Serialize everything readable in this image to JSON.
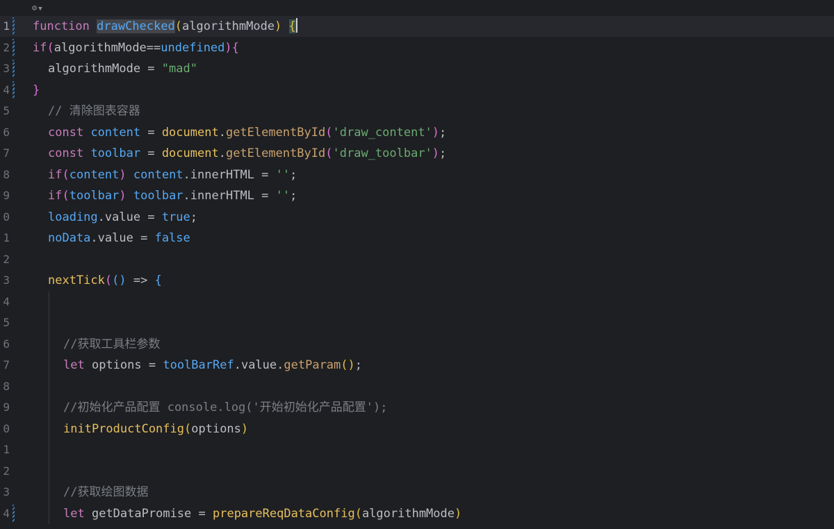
{
  "editor": {
    "inlay_hint": {
      "icon": "ai-assistant-icon"
    },
    "current_line": 1,
    "lines": [
      {
        "number": "1",
        "indent": 0,
        "tokens": [
          [
            "function",
            "kw2"
          ],
          [
            " "
          ],
          [
            "drawChecked",
            "fnhl"
          ],
          [
            "(",
            "p1"
          ],
          [
            "algorithmMode",
            "param"
          ],
          [
            ")",
            "p1"
          ],
          [
            " "
          ],
          [
            "{",
            "brhl"
          ]
        ]
      },
      {
        "number": "2",
        "indent": 0,
        "tokens": [
          [
            "if",
            "kw2"
          ],
          [
            "(",
            "p2"
          ],
          [
            "algorithmMode",
            "param"
          ],
          [
            "==",
            "op"
          ],
          [
            "undefined",
            "fn"
          ],
          [
            ")",
            "p2"
          ],
          [
            "{",
            "p2"
          ]
        ]
      },
      {
        "number": "3",
        "indent": 1,
        "tokens": [
          [
            "algorithmMode",
            "param"
          ],
          [
            " = "
          ],
          [
            "\"mad\"",
            "str"
          ]
        ]
      },
      {
        "number": "4",
        "indent": 0,
        "tokens": [
          [
            "}",
            "p2"
          ]
        ]
      },
      {
        "number": "5",
        "indent": 1,
        "tokens": [
          [
            "// 清除图表容器",
            "cmt"
          ]
        ]
      },
      {
        "number": "6",
        "indent": 1,
        "tokens": [
          [
            "const",
            "kw2"
          ],
          [
            " "
          ],
          [
            "content",
            "local"
          ],
          [
            " = "
          ],
          [
            "document",
            "fncall"
          ],
          [
            "."
          ],
          [
            "getElementById",
            "method"
          ],
          [
            "(",
            "p2"
          ],
          [
            "'draw_content'",
            "str"
          ],
          [
            ")",
            "p2"
          ],
          [
            ";"
          ]
        ]
      },
      {
        "number": "7",
        "indent": 1,
        "tokens": [
          [
            "const",
            "kw2"
          ],
          [
            " "
          ],
          [
            "toolbar",
            "local"
          ],
          [
            " = "
          ],
          [
            "document",
            "fncall"
          ],
          [
            "."
          ],
          [
            "getElementById",
            "method"
          ],
          [
            "(",
            "p2"
          ],
          [
            "'draw_toolbar'",
            "str"
          ],
          [
            ")",
            "p2"
          ],
          [
            ";"
          ]
        ]
      },
      {
        "number": "8",
        "indent": 1,
        "tokens": [
          [
            "if",
            "kw2"
          ],
          [
            "(",
            "p2"
          ],
          [
            "content",
            "local"
          ],
          [
            ")",
            "p2"
          ],
          [
            " "
          ],
          [
            "content",
            "local"
          ],
          [
            "."
          ],
          [
            "innerHTML",
            "var"
          ],
          [
            " = "
          ],
          [
            "''",
            "str"
          ],
          [
            ";"
          ]
        ]
      },
      {
        "number": "9",
        "indent": 1,
        "tokens": [
          [
            "if",
            "kw2"
          ],
          [
            "(",
            "p2"
          ],
          [
            "toolbar",
            "local"
          ],
          [
            ")",
            "p2"
          ],
          [
            " "
          ],
          [
            "toolbar",
            "local"
          ],
          [
            "."
          ],
          [
            "innerHTML",
            "var"
          ],
          [
            " = "
          ],
          [
            "''",
            "str"
          ],
          [
            ";"
          ]
        ]
      },
      {
        "number": "0",
        "indent": 1,
        "tokens": [
          [
            "loading",
            "local"
          ],
          [
            "."
          ],
          [
            "value",
            "var"
          ],
          [
            " = "
          ],
          [
            "true",
            "fn"
          ],
          [
            ";"
          ]
        ]
      },
      {
        "number": "1",
        "indent": 1,
        "tokens": [
          [
            "noData",
            "local"
          ],
          [
            "."
          ],
          [
            "value",
            "var"
          ],
          [
            " = "
          ],
          [
            "false",
            "fn"
          ]
        ]
      },
      {
        "number": "2",
        "indent": 0,
        "tokens": []
      },
      {
        "number": "3",
        "indent": 1,
        "tokens": [
          [
            "nextTick",
            "fncall"
          ],
          [
            "(",
            "p2"
          ],
          [
            "()",
            "p3"
          ],
          [
            " => "
          ],
          [
            "{",
            "p3"
          ]
        ]
      },
      {
        "number": "4",
        "indent": 2,
        "tokens": []
      },
      {
        "number": "5",
        "indent": 2,
        "tokens": []
      },
      {
        "number": "6",
        "indent": 2,
        "tokens": [
          [
            "//获取工具栏参数",
            "cmt"
          ]
        ]
      },
      {
        "number": "7",
        "indent": 2,
        "tokens": [
          [
            "let",
            "kw2"
          ],
          [
            " "
          ],
          [
            "options",
            "var"
          ],
          [
            " = "
          ],
          [
            "toolBarRef",
            "local"
          ],
          [
            "."
          ],
          [
            "value",
            "var"
          ],
          [
            "."
          ],
          [
            "getParam",
            "method"
          ],
          [
            "(",
            "p1"
          ],
          [
            ")",
            "p1"
          ],
          [
            ";"
          ]
        ]
      },
      {
        "number": "8",
        "indent": 2,
        "tokens": []
      },
      {
        "number": "9",
        "indent": 2,
        "tokens": [
          [
            "//初始化产品配置 console.log('开始初始化产品配置');",
            "cmt"
          ]
        ]
      },
      {
        "number": "0",
        "indent": 2,
        "tokens": [
          [
            "initProductConfig",
            "fncall"
          ],
          [
            "(",
            "p1"
          ],
          [
            "options",
            "var"
          ],
          [
            ")",
            "p1"
          ]
        ]
      },
      {
        "number": "1",
        "indent": 2,
        "tokens": []
      },
      {
        "number": "2",
        "indent": 2,
        "tokens": []
      },
      {
        "number": "3",
        "indent": 2,
        "tokens": [
          [
            "//获取绘图数据",
            "cmt"
          ]
        ]
      },
      {
        "number": "4",
        "indent": 2,
        "tokens": [
          [
            "let",
            "kw2"
          ],
          [
            " "
          ],
          [
            "getDataPromise",
            "var"
          ],
          [
            " = "
          ],
          [
            "prepareReqDataConfig",
            "fncall"
          ],
          [
            "(",
            "p1"
          ],
          [
            "algorithmMode",
            "var"
          ],
          [
            ")",
            "p1"
          ]
        ]
      }
    ],
    "gutter_marks": [
      1,
      2,
      3,
      4,
      24
    ]
  }
}
